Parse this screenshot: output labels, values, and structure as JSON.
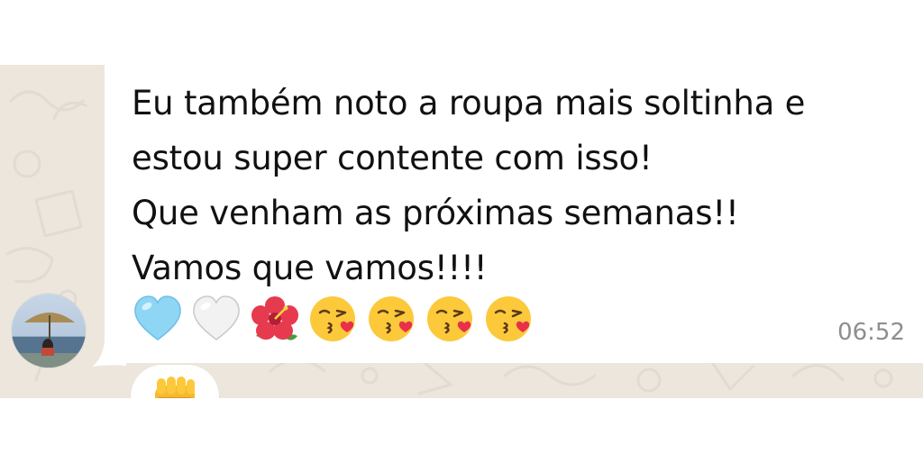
{
  "message": {
    "lines": [
      "Eu também noto a roupa mais soltinha e",
      "estou super contente com isso!",
      "Que venham as próximas semanas!!",
      "Vamos que vamos!!!!"
    ],
    "emojis": [
      "light-blue-heart-icon",
      "white-heart-icon",
      "hibiscus-icon",
      "face-blowing-kiss-icon",
      "face-blowing-kiss-icon",
      "face-blowing-kiss-icon",
      "face-blowing-kiss-icon"
    ],
    "time": "06:52"
  },
  "reaction": {
    "icon": "raised-fist-icon"
  },
  "colors": {
    "chat_background": "#ece6dd",
    "bubble": "#ffffff",
    "text": "#111111",
    "timestamp": "#8e8e8e"
  }
}
